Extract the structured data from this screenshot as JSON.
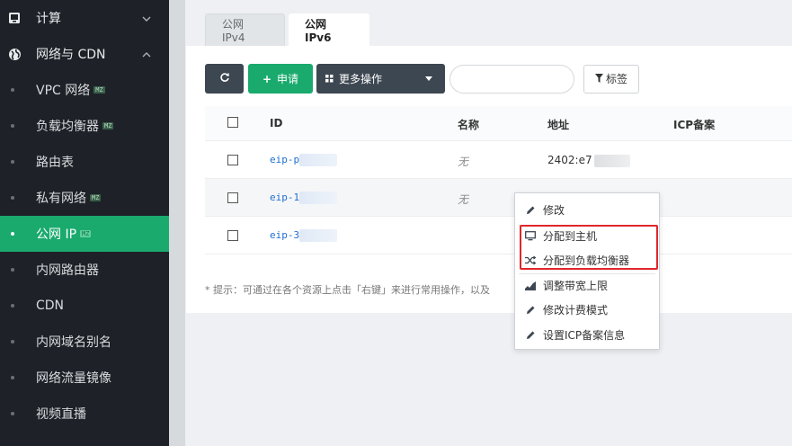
{
  "sidebar": {
    "groups": [
      {
        "label": "计算",
        "icon": "monitor-icon",
        "expanded": false
      },
      {
        "label": "网络与 CDN",
        "icon": "globe-icon",
        "expanded": true
      }
    ],
    "items": [
      {
        "label": "VPC 网络",
        "badge": "MZ"
      },
      {
        "label": "负载均衡器",
        "badge": "MZ"
      },
      {
        "label": "路由表",
        "badge": ""
      },
      {
        "label": "私有网络",
        "badge": "MZ"
      },
      {
        "label": "公网 IP",
        "badge": "MZ",
        "active": true
      },
      {
        "label": "内网路由器",
        "badge": ""
      },
      {
        "label": "CDN",
        "badge": ""
      },
      {
        "label": "内网域名别名",
        "badge": ""
      },
      {
        "label": "网络流量镜像",
        "badge": ""
      },
      {
        "label": "视频直播",
        "badge": ""
      }
    ]
  },
  "tabs": [
    {
      "label": "公网 IPv4",
      "active": false
    },
    {
      "label": "公网 IPv6",
      "active": true
    }
  ],
  "toolbar": {
    "apply_label": "申请",
    "more_label": "更多操作",
    "search_value": "",
    "tag_label": "标签"
  },
  "table": {
    "headers": {
      "id": "ID",
      "name": "名称",
      "address": "地址",
      "icp": "ICP备案"
    },
    "rows": [
      {
        "id": "eip-p",
        "name": "无",
        "address": "2402:e7"
      },
      {
        "id": "eip-1",
        "name": "无",
        "address": ""
      },
      {
        "id": "eip-3",
        "name": "",
        "address": ""
      }
    ]
  },
  "tip": "* 提示：可通过在各个资源上点击「右键」来进行常用操作，以及",
  "context_menu": {
    "items": [
      {
        "label": "修改",
        "icon": "pencil-icon"
      },
      {
        "label": "分配到主机",
        "icon": "monitor-icon"
      },
      {
        "label": "分配到负载均衡器",
        "icon": "shuffle-icon"
      },
      {
        "label": "调整带宽上限",
        "icon": "bandwidth-chart-icon"
      },
      {
        "label": "修改计费模式",
        "icon": "pencil-icon"
      },
      {
        "label": "设置ICP备案信息",
        "icon": "pencil-icon"
      }
    ]
  },
  "colors": {
    "sidebar_bg": "#1e2228",
    "active_green": "#1aaa6e",
    "dark_button": "#3d4751",
    "link_blue": "#1e6fd0",
    "highlight_red": "#e0262b"
  }
}
